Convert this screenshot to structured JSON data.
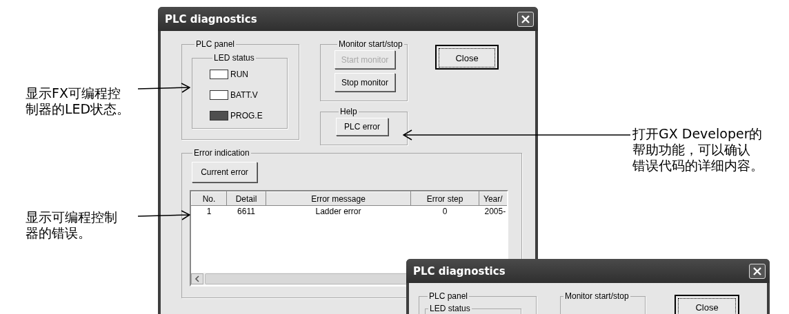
{
  "dialog": {
    "title": "PLC diagnostics",
    "plc_panel": {
      "legend": "PLC panel",
      "led_status": {
        "legend": "LED status",
        "leds": [
          {
            "label": "RUN",
            "on": false
          },
          {
            "label": "BATT.V",
            "on": false
          },
          {
            "label": "PROG.E",
            "on": true
          }
        ]
      }
    },
    "monitor": {
      "legend": "Monitor start/stop",
      "buttons": [
        {
          "label": "Start monitor",
          "disabled": true
        },
        {
          "label": "Stop monitor",
          "disabled": false
        }
      ]
    },
    "help": {
      "legend": "Help",
      "button": "PLC error"
    },
    "close_button": "Close",
    "error_indication": {
      "legend": "Error indication",
      "button": "Current error",
      "table": {
        "columns": [
          "No.",
          "Detail",
          "Error message",
          "Error step",
          "Year/"
        ],
        "rows": [
          [
            "1",
            "6611",
            "Ladder error",
            "0",
            "2005-"
          ]
        ]
      }
    }
  },
  "dialog_2": {
    "title": "PLC diagnostics",
    "plc_panel_legend": "PLC panel",
    "led_status_legend": "LED status",
    "monitor_legend": "Monitor start/stop",
    "close_button": "Close"
  },
  "annotations": [
    {
      "kind": "left",
      "lines": [
        "显示FX可编程控",
        "制器的LED状态。"
      ]
    },
    {
      "kind": "left",
      "lines": [
        "显示可编程控制",
        "器的错误。"
      ]
    },
    {
      "kind": "right",
      "lines": [
        "打开GX Developer的",
        "帮助功能，可以确认",
        "错误代码的详细内容。"
      ]
    }
  ]
}
